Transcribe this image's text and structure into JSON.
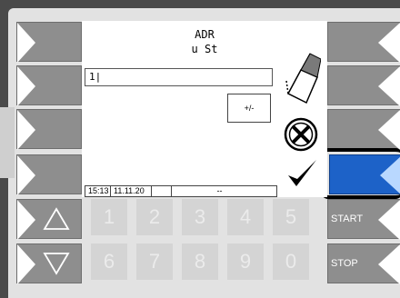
{
  "screen": {
    "title": "ADR",
    "subtitle": "u St",
    "input_value": "1|",
    "sign_button": "+/-"
  },
  "status_bar": {
    "time": "15:13",
    "date": "11.11.20",
    "blank": "",
    "value": "--"
  },
  "keypad": {
    "row1": [
      "1",
      "2",
      "3",
      "4",
      "5"
    ],
    "row2": [
      "6",
      "7",
      "8",
      "9",
      "0"
    ]
  },
  "buttons": {
    "start": "START",
    "stop": "STOP"
  },
  "colors": {
    "active_softkey": "#1d62c8",
    "softkey": "#8e8e8e",
    "numkey_disabled": "#d4d4d4"
  },
  "icons": {
    "eraser": "eraser-icon",
    "cancel": "cancel-circle-x-icon",
    "ok": "checkmark-icon",
    "up": "triangle-up-icon",
    "down": "triangle-down-icon"
  }
}
